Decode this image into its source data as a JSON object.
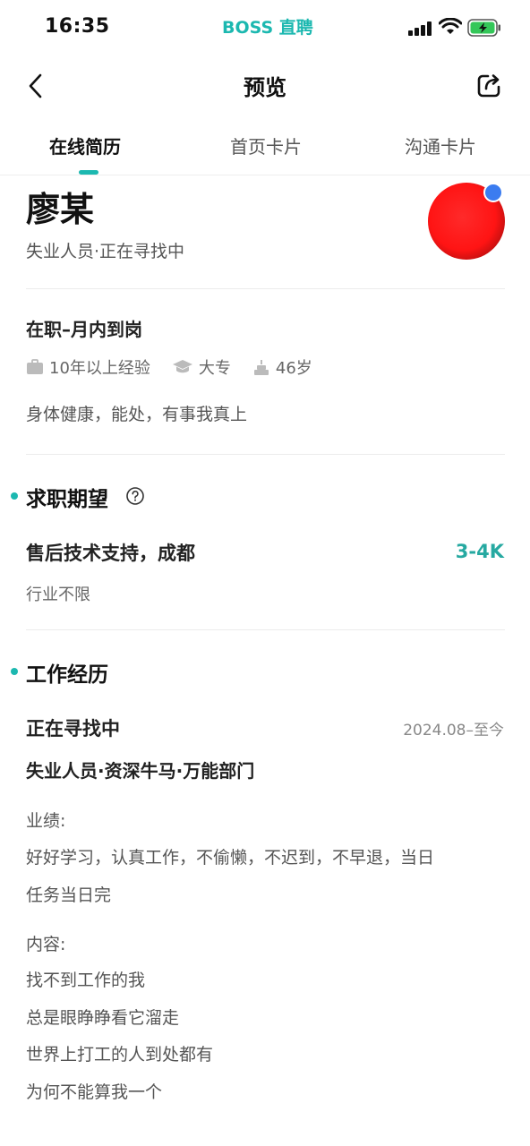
{
  "status_bar": {
    "time": "16:35",
    "app_brand": "BOSS 直聘",
    "icons": [
      "signal-icon",
      "wifi-icon",
      "battery-charging-icon"
    ]
  },
  "nav": {
    "title": "预览",
    "back_icon": "chevron-left-icon",
    "share_icon": "share-icon"
  },
  "tabs": [
    {
      "label": "在线简历",
      "active": true
    },
    {
      "label": "首页卡片",
      "active": false
    },
    {
      "label": "沟通卡片",
      "active": false
    }
  ],
  "profile": {
    "name": "廖某",
    "subtitle": "失业人员·正在寻找中",
    "status": "在职–月内到岗",
    "experience": "10年以上经验",
    "education": "大专",
    "age": "46岁",
    "bio": "身体健康，能处，有事我真上"
  },
  "expectation": {
    "section_title": "求职期望",
    "job": "售后技术支持，成都",
    "salary": "3-4K",
    "industry": "行业不限"
  },
  "work": {
    "section_title": "工作经历",
    "company": "正在寻找中",
    "period": "2024.08–至今",
    "position": "失业人员·资深牛马·万能部门",
    "achievement_label": "业绩:",
    "achievement_lines": [
      "好好学习，认真工作，不偷懒，不迟到，不早退，当日",
      "任务当日完"
    ],
    "content_label": "内容:",
    "content_lines": [
      "找不到工作的我",
      "总是眼睁睁看它溜走",
      "世界上打工的人到处都有",
      "为何不能算我一个"
    ]
  },
  "colors": {
    "accent": "#1cb8b0",
    "salary": "#26a9a1"
  }
}
